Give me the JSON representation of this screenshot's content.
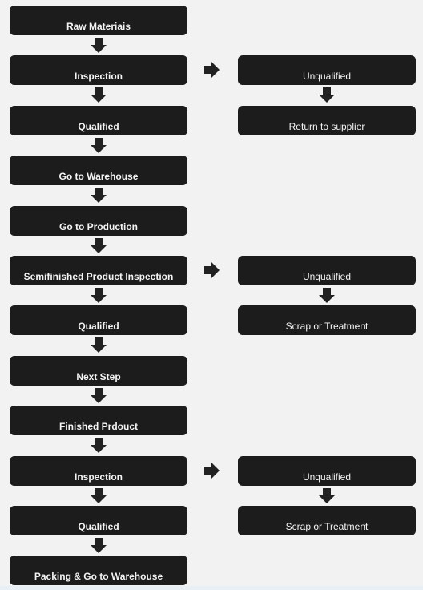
{
  "main_flow": [
    "Raw Materiais",
    "Inspection",
    "Qualified",
    "Go to Warehouse",
    "Go to Production",
    "Semifinished Product Inspection",
    "Qualified",
    "Next Step",
    "Finished Prdouct",
    "Inspection",
    "Qualified",
    "Packing & Go to Warehouse"
  ],
  "branches": [
    {
      "unqualified": "Unqualified",
      "action": "Return to supplier"
    },
    {
      "unqualified": "Unqualified",
      "action": "Scrap or Treatment"
    },
    {
      "unqualified": "Unqualified",
      "action": "Scrap or Treatment"
    }
  ],
  "colors": {
    "background": "#f2f2f2",
    "box": "#1c1c1c",
    "text": "#f4f4f4",
    "arrow": "#222222"
  }
}
